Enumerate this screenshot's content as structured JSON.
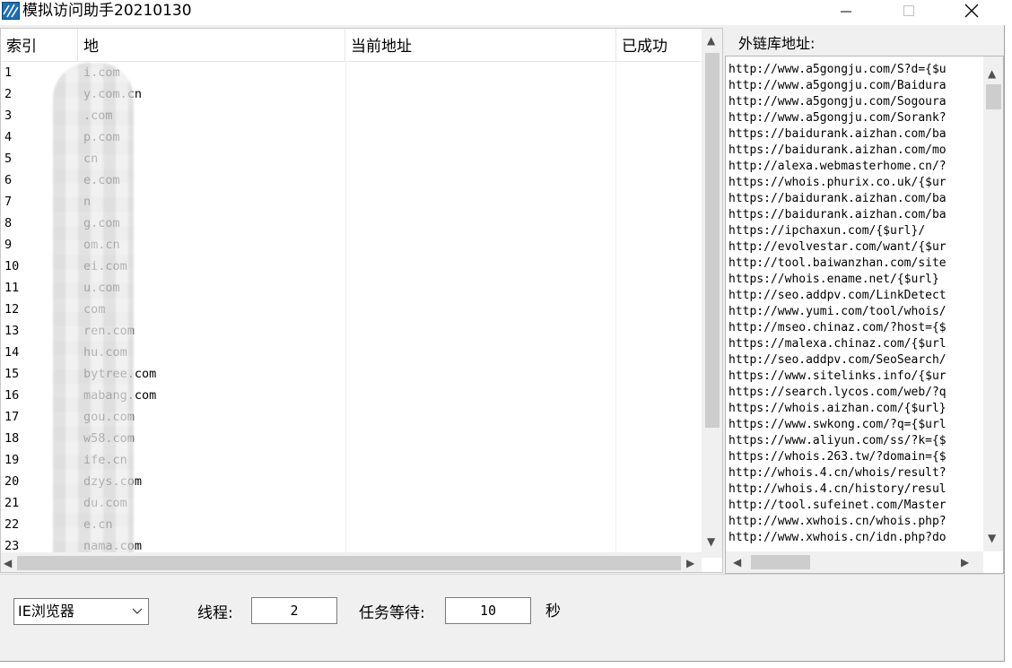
{
  "window": {
    "title": "模拟访问助手20210130"
  },
  "list": {
    "columns": [
      "索引",
      "地",
      "当前地址",
      "已成功"
    ],
    "rows": [
      {
        "index": "1",
        "address": "i.com"
      },
      {
        "index": "2",
        "address": "y.com.cn"
      },
      {
        "index": "3",
        "address": ".com"
      },
      {
        "index": "4",
        "address": "p.com"
      },
      {
        "index": "5",
        "address": "cn"
      },
      {
        "index": "6",
        "address": "e.com"
      },
      {
        "index": "7",
        "address": "n"
      },
      {
        "index": "8",
        "address": "g.com"
      },
      {
        "index": "9",
        "address": "om.cn"
      },
      {
        "index": "10",
        "address": "ei.com"
      },
      {
        "index": "11",
        "address": "u.com"
      },
      {
        "index": "12",
        "address": "com"
      },
      {
        "index": "13",
        "address": "ren.com"
      },
      {
        "index": "14",
        "address": "hu.com"
      },
      {
        "index": "15",
        "address": "bytree.com"
      },
      {
        "index": "16",
        "address": "mabang.com"
      },
      {
        "index": "17",
        "address": "gou.com"
      },
      {
        "index": "18",
        "address": "w58.com"
      },
      {
        "index": "19",
        "address": "ife.cn"
      },
      {
        "index": "20",
        "address": "dzys.com"
      },
      {
        "index": "21",
        "address": "du.com"
      },
      {
        "index": "22",
        "address": "e.cn"
      },
      {
        "index": "23",
        "address": "nama.com"
      }
    ]
  },
  "links": {
    "label": "外链库地址:",
    "lines": [
      "http://www.a5gongju.com/S?d={$u",
      "http://www.a5gongju.com/Baidura",
      "http://www.a5gongju.com/Sogoura",
      "http://www.a5gongju.com/Sorank?",
      "https://baidurank.aizhan.com/ba",
      "https://baidurank.aizhan.com/mo",
      "http://alexa.webmasterhome.cn/?",
      "https://whois.phurix.co.uk/{$ur",
      "https://baidurank.aizhan.com/ba",
      "https://baidurank.aizhan.com/ba",
      "https://ipchaxun.com/{$url}/",
      "http://evolvestar.com/want/{$ur",
      "http://tool.baiwanzhan.com/site",
      "https://whois.ename.net/{$url}",
      "http://seo.addpv.com/LinkDetect",
      "http://www.yumi.com/tool/whois/",
      "http://mseo.chinaz.com/?host={$",
      "https://malexa.chinaz.com/{$url",
      "http://seo.addpv.com/SeoSearch/",
      "https://www.sitelinks.info/{$ur",
      "https://search.lycos.com/web/?q",
      "https://whois.aizhan.com/{$url}",
      "https://www.swkong.com/?q={$url",
      "https://www.aliyun.com/ss/?k={$",
      "https://whois.263.tw/?domain={$",
      "http://whois.4.cn/whois/result?",
      "http://whois.4.cn/history/resul",
      "http://tool.sufeinet.com/Master",
      "http://www.xwhois.cn/whois.php?",
      "http://www.xwhois.cn/idn.php?do"
    ]
  },
  "controls": {
    "browser_select": "IE浏览器",
    "threads_label": "线程:",
    "threads_value": "2",
    "wait_label": "任务等待:",
    "wait_value": "10",
    "wait_unit": "秒"
  }
}
